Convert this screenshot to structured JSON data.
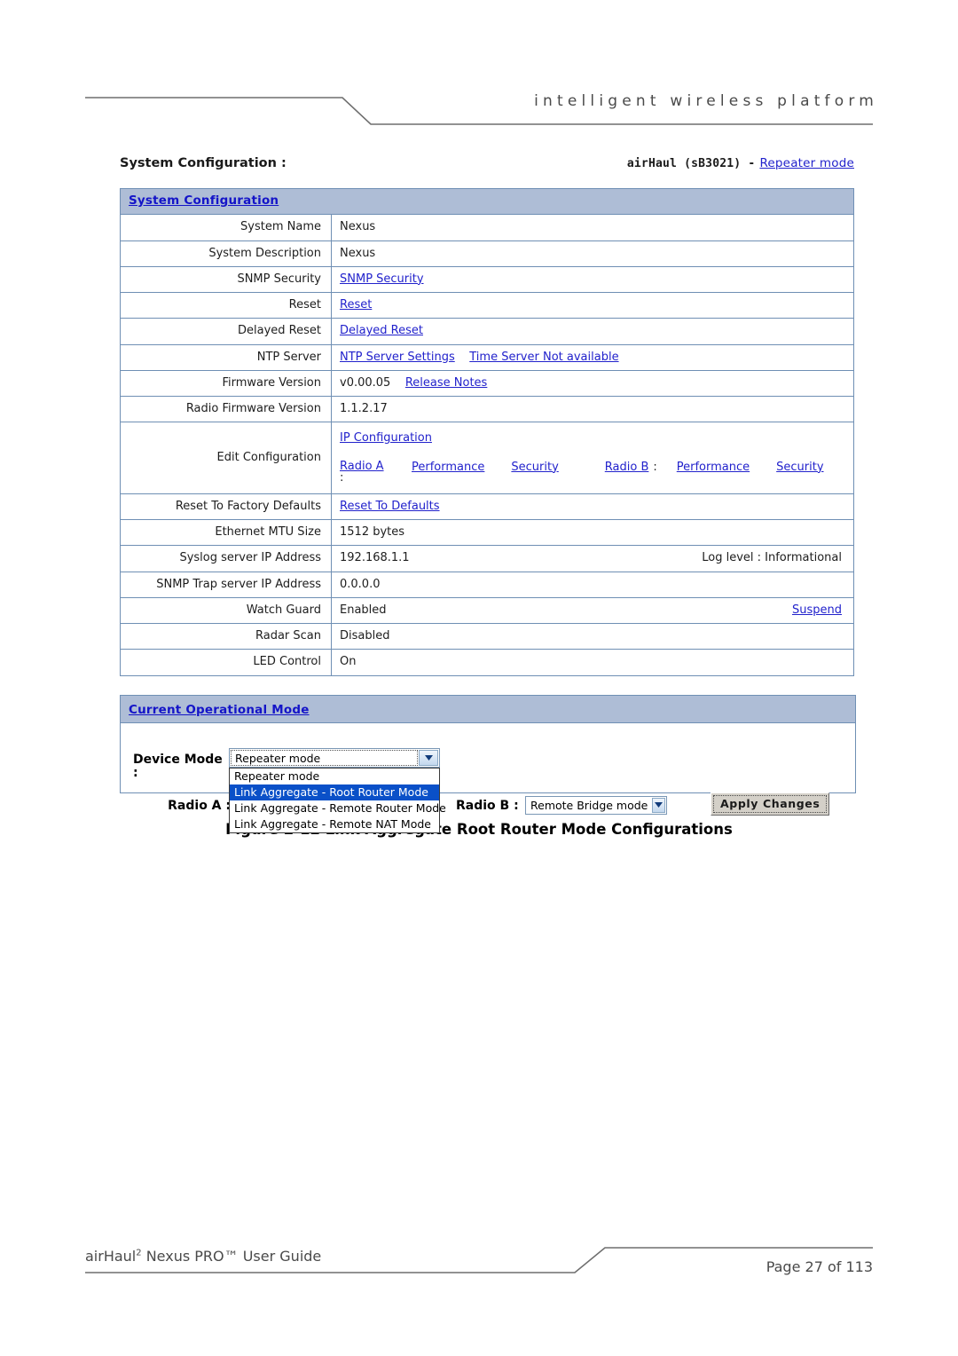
{
  "header": {
    "tagline": "intelligent   wireless   platform"
  },
  "figure": {
    "title": "System Configuration :",
    "device_model": "airHaul (sB3021) -",
    "device_mode_link": "Repeater mode",
    "caption": "Figure 2-12 Link Aggregate Root Router Mode Configurations"
  },
  "system_config": {
    "panel_title": "System Configuration",
    "rows": [
      {
        "label": "System Name",
        "value": "Nexus",
        "kind": "text"
      },
      {
        "label": "System Description",
        "value": "Nexus",
        "kind": "text"
      },
      {
        "label": "SNMP Security",
        "value": "SNMP Security",
        "kind": "link"
      },
      {
        "label": "Reset",
        "value": "Reset",
        "kind": "link"
      },
      {
        "label": "Delayed Reset",
        "value": "Delayed Reset",
        "kind": "link"
      },
      {
        "label": "NTP Server",
        "value": "NTP Server Settings",
        "value2": "Time Server Not available",
        "kind": "link2"
      },
      {
        "label": "Firmware Version",
        "value": "v0.00.05",
        "value2": "Release Notes",
        "kind": "text-link"
      },
      {
        "label": "Radio Firmware Version",
        "value": "1.1.2.17",
        "kind": "text"
      }
    ],
    "edit_configuration": {
      "label": "Edit Configuration",
      "ip_configuration": "IP Configuration",
      "radio_a": "Radio A",
      "radio_a_colon": ":",
      "radio_a_performance": "Performance",
      "radio_a_security": "Security",
      "radio_b": "Radio B",
      "radio_b_colon": ":",
      "radio_b_performance": "Performance",
      "radio_b_security": "Security"
    },
    "rows_after": [
      {
        "label": "Reset To Factory Defaults",
        "value": "Reset To Defaults",
        "kind": "link"
      },
      {
        "label": "Ethernet MTU Size",
        "value": "1512 bytes",
        "kind": "text"
      },
      {
        "label": "Syslog server IP Address",
        "value": "192.168.1.1",
        "right_note": "Log level : Informational",
        "kind": "text-note"
      },
      {
        "label": "SNMP Trap server IP Address",
        "value": "0.0.0.0",
        "kind": "text"
      },
      {
        "label": "Watch Guard",
        "value": "Enabled",
        "right_link": "Suspend",
        "kind": "text-rightlink"
      },
      {
        "label": "Radar Scan",
        "value": "Disabled",
        "kind": "text"
      },
      {
        "label": "LED Control",
        "value": "On",
        "kind": "text"
      }
    ]
  },
  "operational_mode": {
    "panel_title": "Current Operational Mode",
    "device_mode_label": "Device Mode",
    "device_mode_colon": ":",
    "device_mode_selected": "Repeater mode",
    "device_mode_options": [
      "Repeater mode",
      "Link Aggregate - Root Router Mode",
      "Link Aggregate - Remote Router Mode",
      "Link Aggregate - Remote NAT Mode"
    ],
    "device_mode_highlighted_index": 1,
    "radio_a_label": "Radio A :",
    "radio_b_label": "Radio B :",
    "radio_b_selected": "Remote Bridge mode",
    "apply_button": "Apply Changes"
  },
  "footer": {
    "left_pre": "airHaul",
    "left_sup": "2",
    "left_post": " Nexus PRO™ User Guide",
    "right": "Page 27 of 113"
  },
  "colors": {
    "panel_bar": "#aebdd6",
    "table_border": "#6f8fb4",
    "link": "#2222cc",
    "bar_title": "#1414c8",
    "dropdown_highlight": "#0a50c8"
  }
}
